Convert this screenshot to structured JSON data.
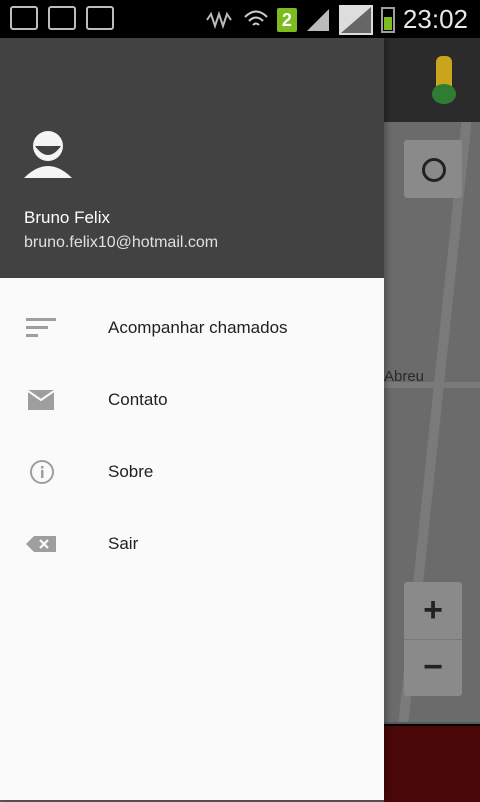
{
  "status_bar": {
    "time": "23:02",
    "sim_badge": "2"
  },
  "map": {
    "street_label": "Abreu",
    "zoom_in_label": "+",
    "zoom_out_label": "−"
  },
  "drawer": {
    "user_name": "Bruno Felix",
    "user_email": "bruno.felix10@hotmail.com",
    "items": [
      {
        "label": "Acompanhar chamados",
        "icon": "list-icon"
      },
      {
        "label": "Contato",
        "icon": "mail-icon"
      },
      {
        "label": "Sobre",
        "icon": "info-icon"
      },
      {
        "label": "Sair",
        "icon": "backspace-icon"
      }
    ]
  },
  "colors": {
    "header": "#424242",
    "drawer_bg": "#fafafa",
    "badge_green": "#7cbc1f",
    "bottom_bar": "#4a0708"
  }
}
